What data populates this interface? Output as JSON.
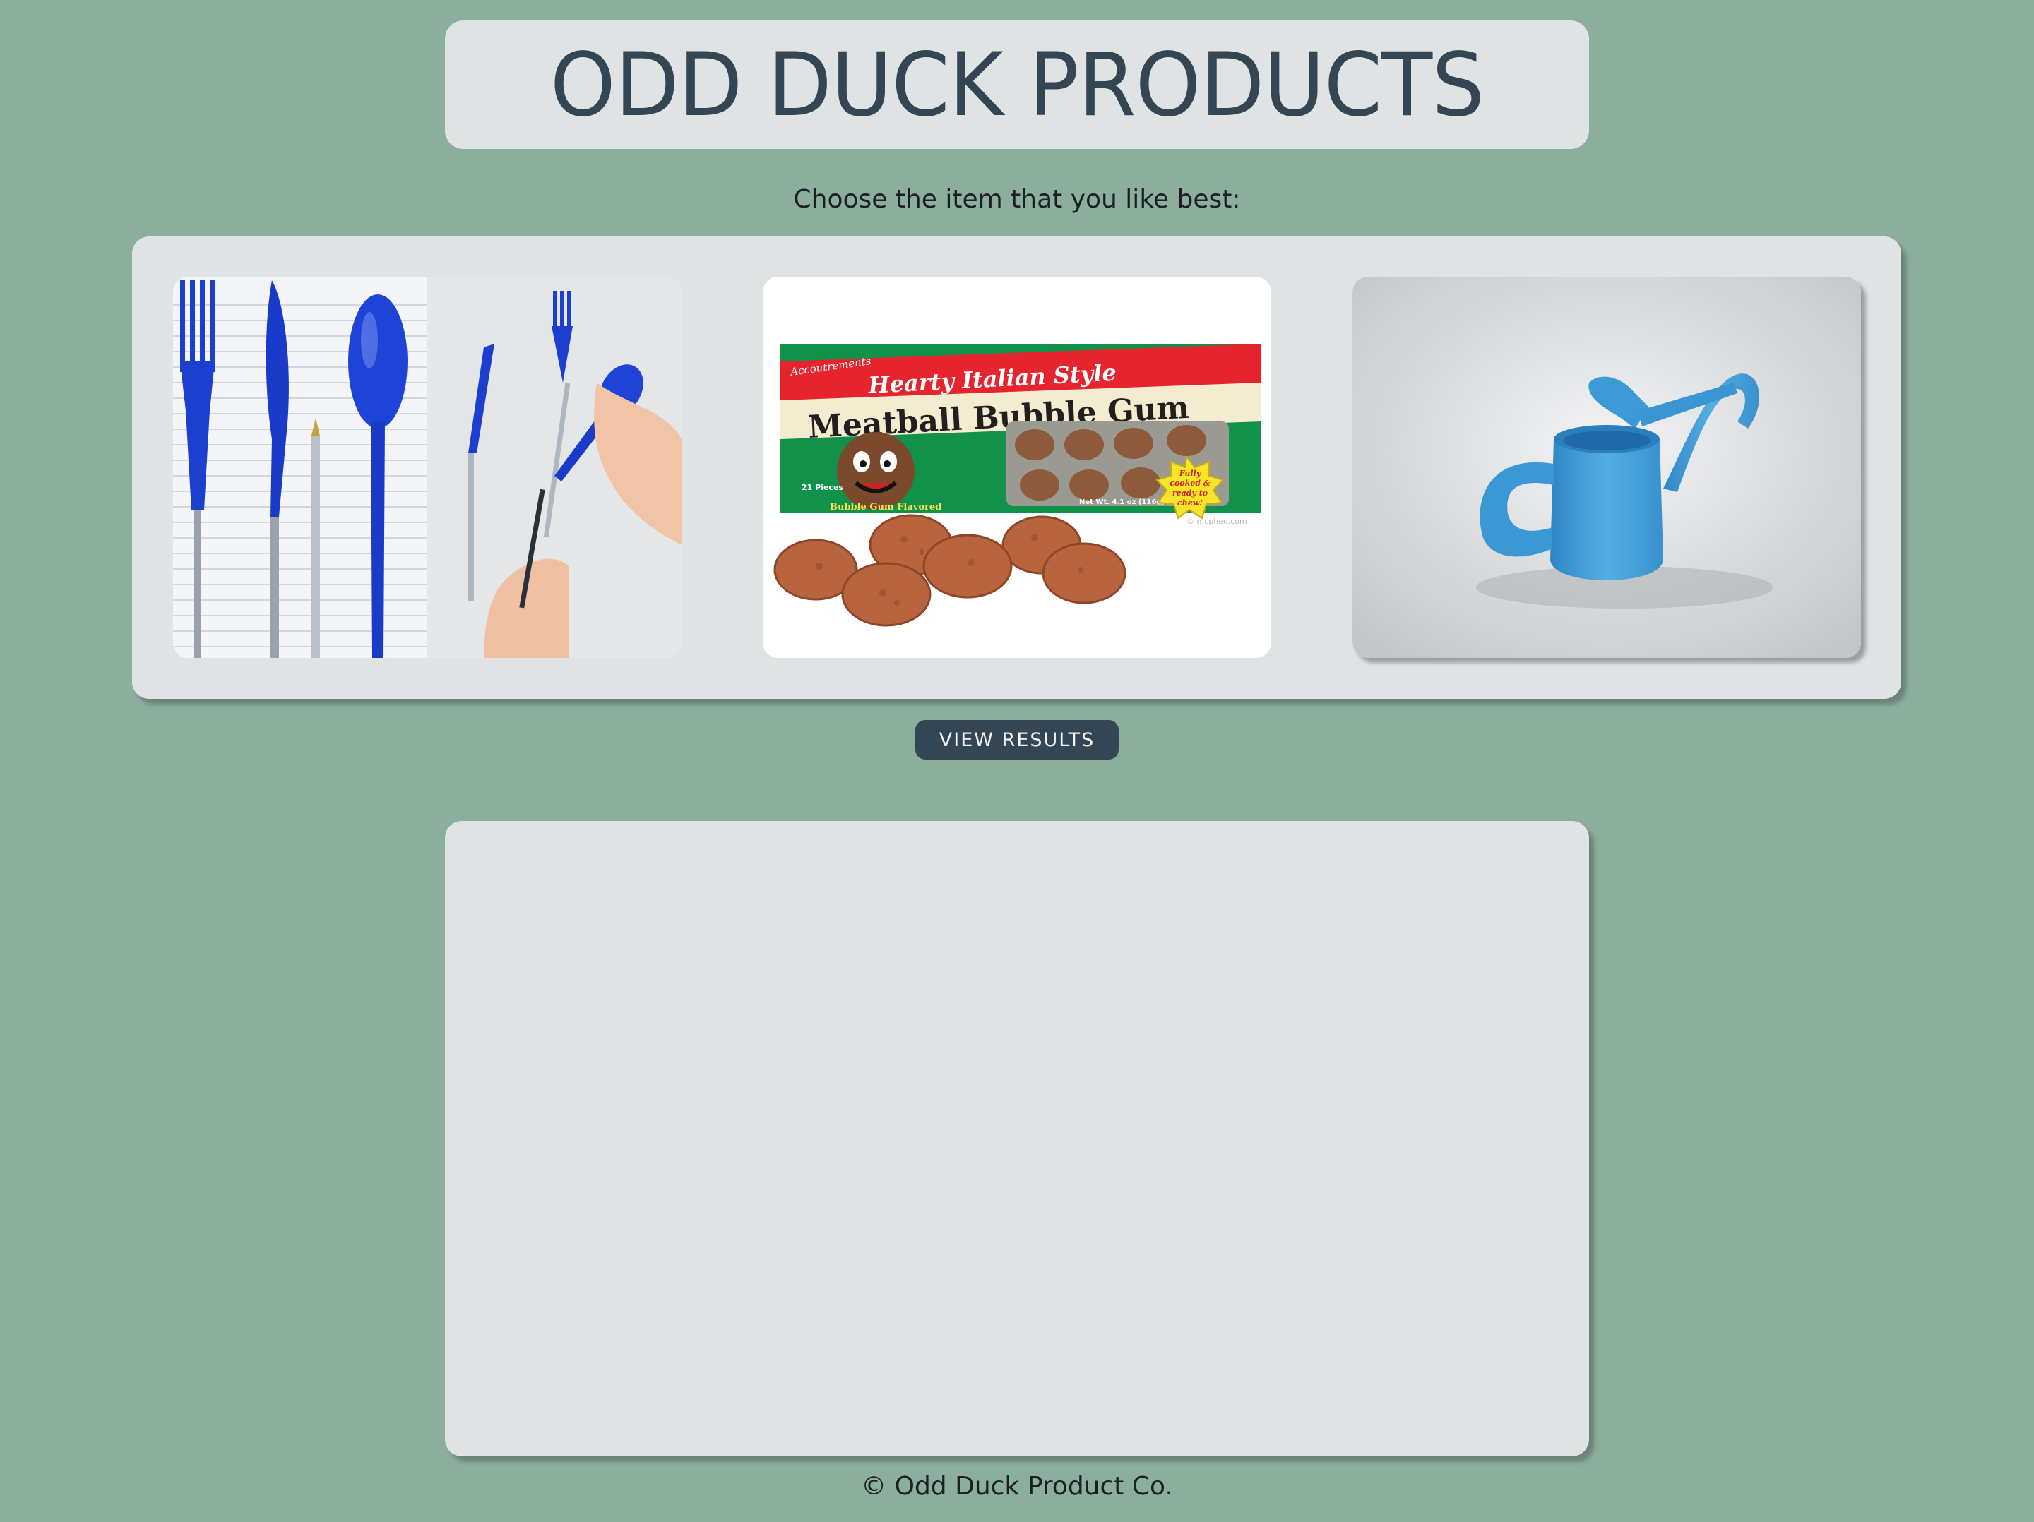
{
  "header": {
    "title": "ODD DUCK PRODUCTS"
  },
  "prompt": "Choose the item that you like best:",
  "products": [
    {
      "name": "pen",
      "icon": "pen-utensils-image"
    },
    {
      "name": "bubblegum",
      "icon": "meatball-bubble-gum-image",
      "package": {
        "brand": "Accoutrements",
        "tagline": "Hearty Italian Style",
        "title": "Meatball Bubble Gum",
        "pieces": "21 Pieces",
        "flavor": "Bubble Gum Flavored",
        "weight": "Net Wt. 4.1 oz (116g)",
        "burst_line1": "Fully",
        "burst_line2": "cooked &",
        "burst_line3": "ready to",
        "burst_line4": "chew!",
        "watermark": "© mcphee.com"
      }
    },
    {
      "name": "water-can",
      "icon": "watering-can-image"
    }
  ],
  "results_button": {
    "label": "VIEW RESULTS"
  },
  "footer": {
    "text": "© Odd Duck Product Co."
  },
  "colors": {
    "background": "#8cae9c",
    "panel": "#dfe3e4",
    "header_text": "#344554",
    "button": "#344554"
  }
}
